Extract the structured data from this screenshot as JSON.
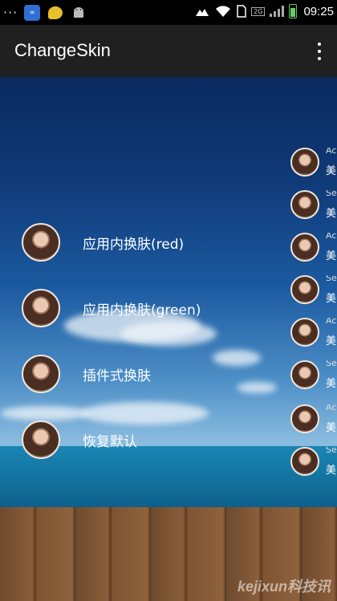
{
  "status_bar": {
    "dots": "···",
    "time": "09:25",
    "network": "2G"
  },
  "app_bar": {
    "title": "ChangeSkin"
  },
  "menu": {
    "items": [
      {
        "label": "应用内换肤(red)"
      },
      {
        "label": "应用内换肤(green)"
      },
      {
        "label": "插件式换肤"
      },
      {
        "label": "恢复默认"
      }
    ]
  },
  "side_list": {
    "items": [
      {
        "name": "Ac",
        "sub": "美"
      },
      {
        "name": "Se",
        "sub": "美"
      },
      {
        "name": "Ac",
        "sub": "美"
      },
      {
        "name": "Se",
        "sub": "美"
      },
      {
        "name": "Ac",
        "sub": "美"
      },
      {
        "name": "Se",
        "sub": "美"
      },
      {
        "name": "Ac",
        "sub": "美"
      },
      {
        "name": "Se",
        "sub": "美"
      }
    ]
  },
  "watermark": "kejixun科技讯"
}
